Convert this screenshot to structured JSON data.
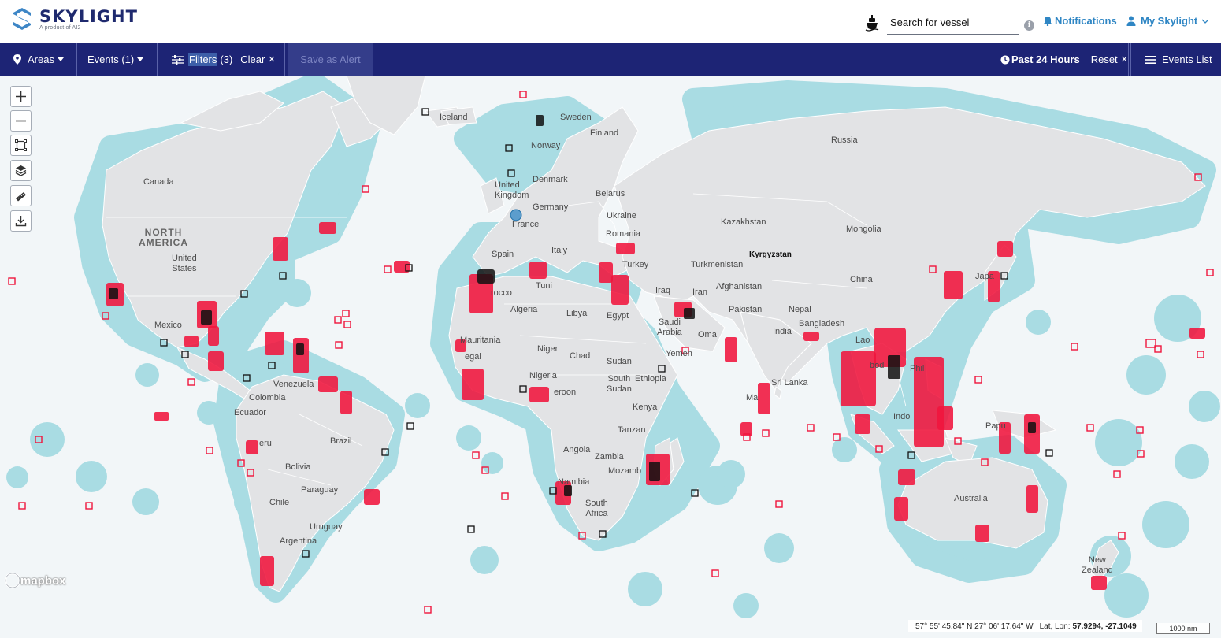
{
  "brand": {
    "name": "SKYLIGHT",
    "tagline": "A product of AI2"
  },
  "header": {
    "search_placeholder": "Search for vessel",
    "info_label": "i",
    "notifications_label": "Notifications",
    "account_label": "My Skylight"
  },
  "toolbar": {
    "areas_label": "Areas",
    "events_label": "Events (1)",
    "filters_label": "Filters",
    "filters_count": "(3)",
    "clear_label": "Clear",
    "save_alert_label": "Save as Alert",
    "time_label": "Past 24 Hours",
    "reset_label": "Reset",
    "events_list_label": "Events List"
  },
  "map": {
    "labels": {
      "iceland": "Iceland",
      "sweden": "Sweden",
      "finland": "Finland",
      "norway": "Norway",
      "russia": "Russia",
      "canada": "Canada",
      "north_america": "NORTH\nAMERICA",
      "united_states": "United\nStates",
      "united_kingdom": "United\nKingdom",
      "denmark": "Denmark",
      "belarus": "Belarus",
      "germany": "Germany",
      "ukraine": "Ukraine",
      "france": "France",
      "romania": "Romania",
      "kazakhstan": "Kazakhstan",
      "mongolia": "Mongolia",
      "spain": "Spain",
      "italy": "Italy",
      "turkey": "Turkey",
      "kyrgyzstan": "Kyrgyzstan",
      "turkmenistan": "Turkmenistan",
      "china": "China",
      "iraq": "Iraq",
      "iran": "Iran",
      "afghanistan": "Afghanistan",
      "morocco": "rocco",
      "tunisia": "Tuni",
      "algeria": "Algeria",
      "libya": "Libya",
      "egypt": "Egypt",
      "saudi_arabia": "Saudi\nArabia",
      "pakistan": "Pakistan",
      "nepal": "Nepal",
      "india": "India",
      "bangladesh": "Bangladesh",
      "japan": "Japa",
      "mexico": "Mexico",
      "mauritania": "Mauritania",
      "niger": "Niger",
      "chad": "Chad",
      "sudan": "Sudan",
      "yemen": "Yemen",
      "oman": "Oma",
      "senegal": "egal",
      "nigeria": "Nigeria",
      "cameroon": "eroon",
      "south_sudan": "South\nSudan",
      "ethiopia": "Ethiopia",
      "sri_lanka": "Sri Lanka",
      "laos": "Lao",
      "cambodia": "bod",
      "philippines": "Phil",
      "venezuela": "Venezuela",
      "colombia": "Colombia",
      "ecuador": "Ecuador",
      "kenya": "Kenya",
      "maldives": "Mal",
      "indonesia": "Indo",
      "peru": "eru",
      "brazil": "Brazil",
      "tanzania": "Tanzan",
      "angola": "Angola",
      "zambia": "Zambia",
      "papua": "Papu",
      "bolivia": "Bolivia",
      "mozambique": "Mozamb",
      "namibia": "Namibia",
      "paraguay": "Paraguay",
      "south_africa": "South\nAfrica",
      "australia": "Australia",
      "chile": "Chile",
      "uruguay": "Uruguay",
      "argentina": "Argentina",
      "new_zealand": "New\nZealand"
    },
    "attribution": "mapbox",
    "coordinates_dms": "57° 55' 45.84\" N 27° 06' 17.64\" W",
    "latlon_label": "Lat, Lon:",
    "latlon_value": "57.9294, -27.1049",
    "scale_label": "1000 nm"
  },
  "colors": {
    "navy": "#1d2475",
    "brand": "#1f2a6e",
    "link": "#2f86c4",
    "land": "#e2e3e5",
    "eez": "#a9dce3",
    "ocean": "#f2f6f8",
    "event_red": "#f0143c",
    "event_black": "#111111"
  },
  "icons": [
    "ship-icon",
    "info-icon",
    "bell-icon",
    "user-icon",
    "location-pin-icon",
    "filter-sliders-icon",
    "clock-icon",
    "list-icon",
    "zoom-in-icon",
    "zoom-out-icon",
    "draw-area-icon",
    "layers-icon",
    "ruler-icon",
    "download-icon",
    "mapbox-logo-icon"
  ]
}
